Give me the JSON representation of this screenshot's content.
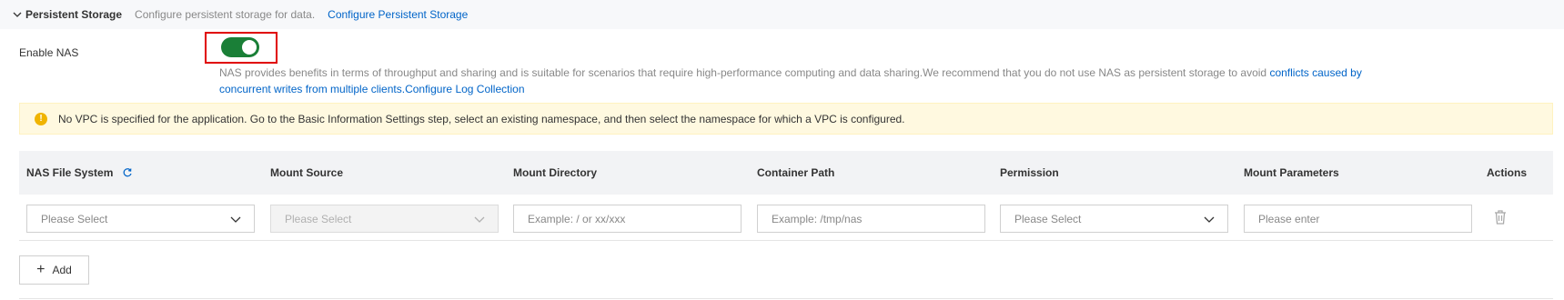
{
  "section": {
    "title": "Persistent Storage",
    "description": "Configure persistent storage for data.",
    "link": "Configure Persistent Storage"
  },
  "nas": {
    "label": "Enable NAS",
    "enabled": true,
    "description_text": "NAS provides benefits in terms of throughput and sharing and is suitable for scenarios that require high-performance computing and data sharing.We recommend that you do not use NAS as persistent storage to avoid ",
    "description_link": "conflicts caused by concurrent writes from multiple clients.",
    "log_link": "Configure Log Collection"
  },
  "warning": {
    "icon": "exclamation-icon",
    "text": "No VPC is specified for the application. Go to the Basic Information Settings step, select an existing namespace, and then select the namespace for which a VPC is configured."
  },
  "table": {
    "headers": {
      "nas_file_system": "NAS File System",
      "mount_source": "Mount Source",
      "mount_directory": "Mount Directory",
      "container_path": "Container Path",
      "permission": "Permission",
      "mount_parameters": "Mount Parameters",
      "actions": "Actions"
    },
    "row": {
      "nas_file_system_placeholder": "Please Select",
      "mount_source_placeholder": "Please Select",
      "mount_directory_placeholder": "Example: / or xx/xxx",
      "container_path_placeholder": "Example: /tmp/nas",
      "permission_placeholder": "Please Select",
      "mount_parameters_placeholder": "Please enter"
    }
  },
  "add_button": {
    "label": "Add"
  },
  "colors": {
    "accent": "#0064c8",
    "toggle_on": "#1a7f37",
    "highlight": "#e00000",
    "warning_bg": "#fff9e0"
  }
}
